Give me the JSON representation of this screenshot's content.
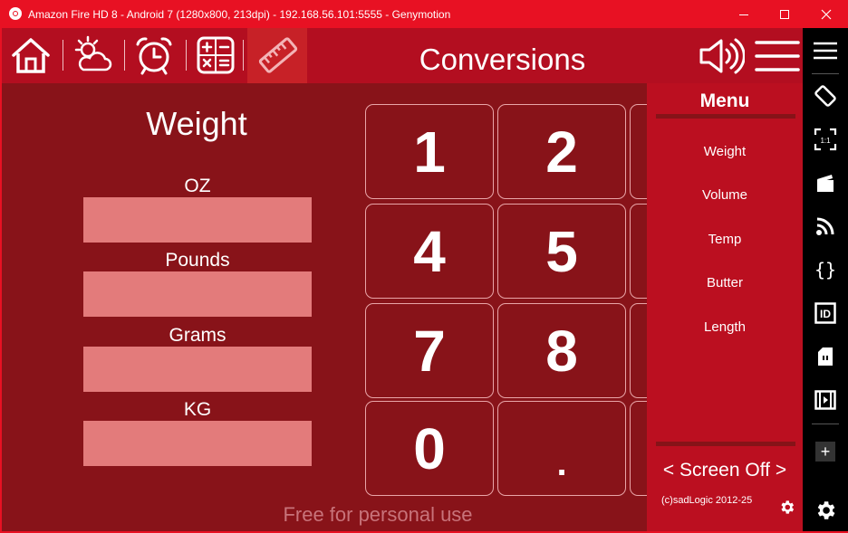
{
  "window": {
    "title": "Amazon Fire HD 8 - Android 7 (1280x800, 213dpi) - 192.168.56.101:5555 - Genymotion",
    "controls": [
      "minimize",
      "maximize",
      "close"
    ]
  },
  "app": {
    "title": "Conversions",
    "nav_icons": [
      "home-icon",
      "weather-icon",
      "alarm-clock-icon",
      "calculator-icon",
      "ruler-icon"
    ],
    "active_nav": "ruler-icon",
    "colors": {
      "accent": "#b30e20",
      "background": "#881319",
      "input": "#e37b7b",
      "window": "#e81123"
    }
  },
  "converter": {
    "section_title": "Weight",
    "fields": [
      {
        "label": "OZ",
        "value": ""
      },
      {
        "label": "Pounds",
        "value": ""
      },
      {
        "label": "Grams",
        "value": ""
      },
      {
        "label": "KG",
        "value": ""
      }
    ]
  },
  "keypad": {
    "keys": [
      "1",
      "2",
      "4",
      "5",
      "7",
      "8",
      "0",
      "."
    ]
  },
  "menu": {
    "title": "Menu",
    "items": [
      "Weight",
      "Volume",
      "Temp",
      "Butter",
      "Length"
    ],
    "screen_off": "<  Screen Off  >",
    "copyright": "(c)sadLogic 2012-25"
  },
  "watermark": "Free for personal use",
  "genymotion_toolbar": [
    "menu-icon",
    "rotate-icon",
    "pixel-perfect-icon",
    "capture-icon",
    "cast-icon",
    "api-icon",
    "device-id-icon",
    "sd-card-icon",
    "media-icon",
    "add-icon",
    "settings-icon"
  ]
}
